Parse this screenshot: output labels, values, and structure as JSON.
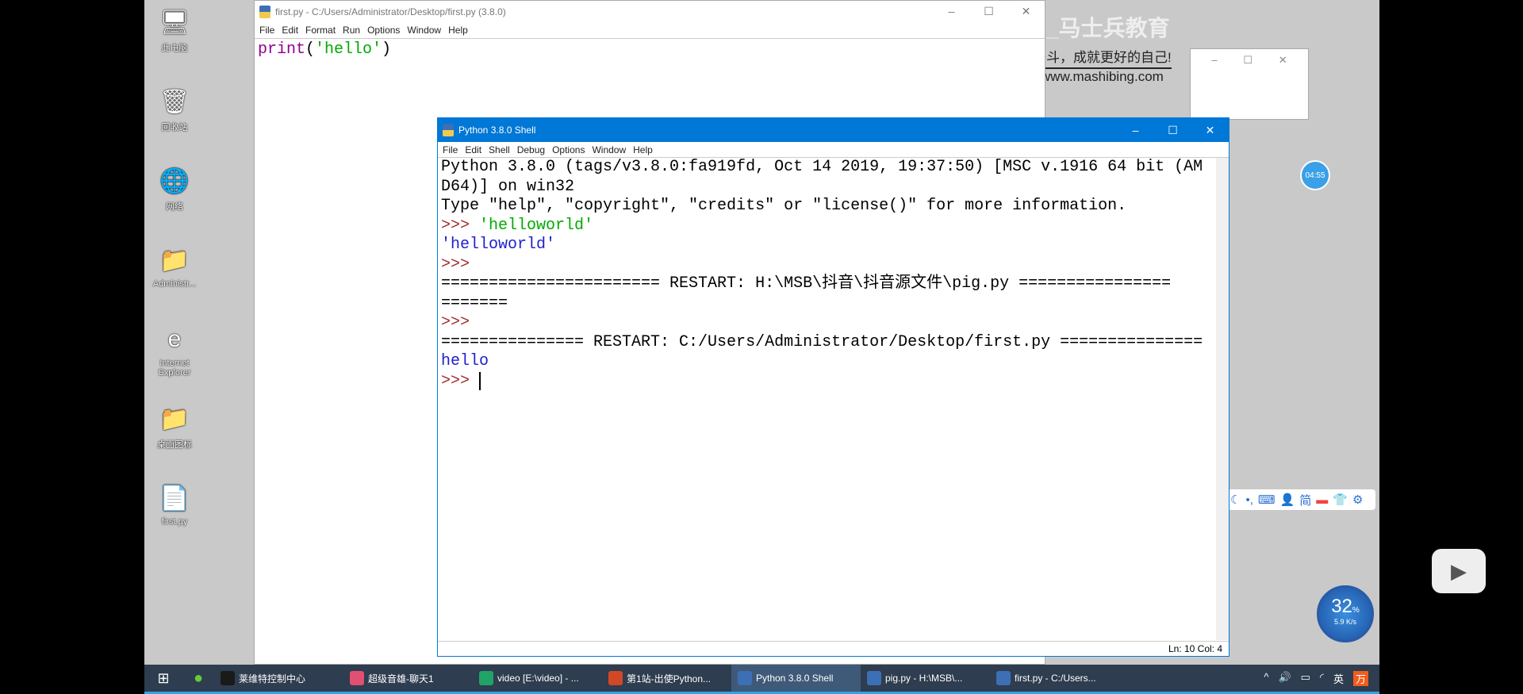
{
  "desktop": {
    "icons": [
      {
        "label": "此电脑",
        "glyph": "🖥"
      },
      {
        "label": "回收站",
        "glyph": "🗑"
      },
      {
        "label": "网络",
        "glyph": "🌐"
      },
      {
        "label": "Administr...",
        "glyph": "📁"
      },
      {
        "label": "Internet Explorer",
        "glyph": "e"
      },
      {
        "label": "桌面图标",
        "glyph": "📁"
      },
      {
        "label": "first.py",
        "glyph": "📄"
      }
    ]
  },
  "editor": {
    "title": "first.py - C:/Users/Administrator/Desktop/first.py (3.8.0)",
    "menu": [
      "File",
      "Edit",
      "Format",
      "Run",
      "Options",
      "Window",
      "Help"
    ],
    "code": {
      "fn": "print",
      "open": "(",
      "str": "'hello'",
      "close": ")"
    }
  },
  "shell": {
    "title": "Python 3.8.0 Shell",
    "menu": [
      "File",
      "Edit",
      "Shell",
      "Debug",
      "Options",
      "Window",
      "Help"
    ],
    "lines": [
      {
        "t": "Python 3.8.0 (tags/v3.8.0:fa919fd, Oct 14 2019, 19:37:50) [MSC v.1916 64 bit (AM",
        "c": ""
      },
      {
        "t": "D64)] on win32",
        "c": ""
      },
      {
        "t": "Type \"help\", \"copyright\", \"credits\" or \"license()\" for more information.",
        "c": ""
      },
      {
        "t": ">>> ",
        "c": "prompt",
        "s": "'helloworld'"
      },
      {
        "t": "'helloworld'",
        "c": "out"
      },
      {
        "t": ">>>",
        "c": "prompt"
      },
      {
        "t": "======================= RESTART: H:\\MSB\\抖音\\抖音源文件\\pig.py ================",
        "c": ""
      },
      {
        "t": "=======",
        "c": ""
      },
      {
        "t": ">>>",
        "c": "prompt"
      },
      {
        "t": "=============== RESTART: C:/Users/Administrator/Desktop/first.py ===============",
        "c": ""
      },
      {
        "t": "hello",
        "c": "out"
      },
      {
        "t": ">>> ",
        "c": "prompt"
      }
    ],
    "status": "Ln: 10  Col: 4"
  },
  "watermark": {
    "brand": "Python_马士兵教育",
    "slogan": "奋斗，成就更好的自己!",
    "url": "www.mashibing.com"
  },
  "timer": "04:55",
  "ime": {
    "items": [
      "英",
      "简"
    ]
  },
  "netmon": {
    "percent": "32",
    "unit": "%",
    "speed": "5.9 K/s"
  },
  "taskbar": {
    "items": [
      {
        "label": "莱维特控制中心",
        "color": "#1a1a1a"
      },
      {
        "label": "超级音雄-聊天1",
        "color": "#e05070"
      },
      {
        "label": "video [E:\\video] - ...",
        "color": "#21a366"
      },
      {
        "label": "第1站-出使Python...",
        "color": "#d24726"
      },
      {
        "label": "Python 3.8.0 Shell",
        "color": "#3d6fb5",
        "active": true
      },
      {
        "label": "pig.py - H:\\MSB\\...",
        "color": "#3d6fb5"
      },
      {
        "label": "first.py - C:/Users...",
        "color": "#3d6fb5"
      }
    ],
    "tray": "英"
  }
}
